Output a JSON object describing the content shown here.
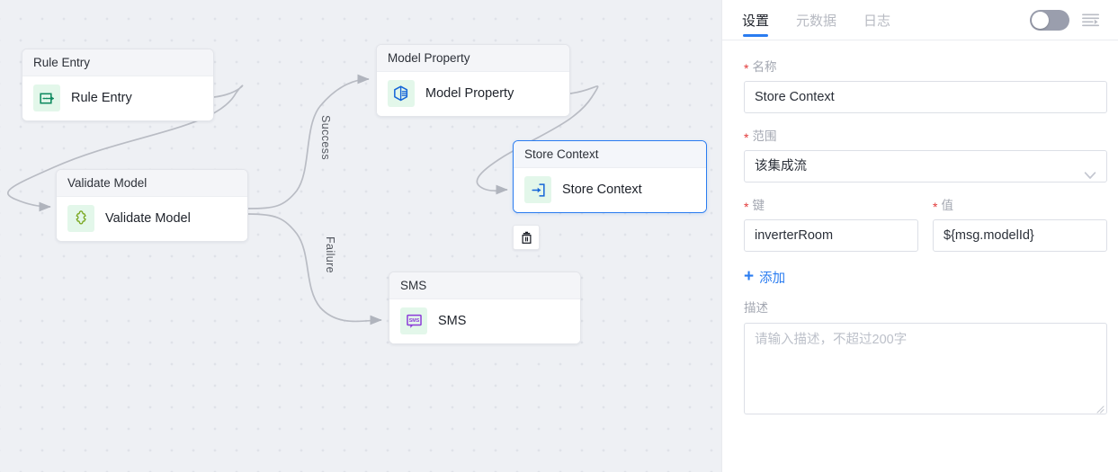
{
  "canvas": {
    "nodes": [
      {
        "id": "rule-entry",
        "header": "Rule Entry",
        "label": "Rule Entry",
        "icon": "rule-entry-icon"
      },
      {
        "id": "validate-model",
        "header": "Validate Model",
        "label": "Validate Model",
        "icon": "puzzle-piece-icon"
      },
      {
        "id": "model-property",
        "header": "Model Property",
        "label": "Model Property",
        "icon": "model-property-icon"
      },
      {
        "id": "store-context",
        "header": "Store Context",
        "label": "Store Context",
        "icon": "store-context-icon"
      },
      {
        "id": "sms",
        "header": "SMS",
        "label": "SMS",
        "icon": "sms-icon"
      }
    ],
    "edge_labels": {
      "success": "Success",
      "failure": "Failure"
    },
    "delete_button": {
      "icon": "trash-icon",
      "tooltip": ""
    },
    "selected_node": "store-context"
  },
  "panel": {
    "tabs": [
      {
        "id": "settings",
        "label": "设置",
        "active": true
      },
      {
        "id": "metadata",
        "label": "元数据",
        "active": false
      },
      {
        "id": "logs",
        "label": "日志",
        "active": false
      }
    ],
    "toggle": {
      "name": "debug-toggle",
      "state": "off"
    },
    "menu_icon": "list-expand-icon",
    "form": {
      "name": {
        "label": "名称",
        "required": "*",
        "value": "Store Context"
      },
      "scope": {
        "label": "范围",
        "required": "*",
        "value": "该集成流",
        "chevron": "chevron-down-icon"
      },
      "key": {
        "label": "键",
        "required": "*",
        "value": "inverterRoom"
      },
      "value": {
        "label": "值",
        "required": "*",
        "value": "${msg.modelId}"
      },
      "add": {
        "label": "添加",
        "plus": "+"
      },
      "description": {
        "label": "描述",
        "placeholder": "请输入描述，不超过200字",
        "value": ""
      }
    }
  },
  "colors": {
    "accent": "#2a7cf0",
    "required": "#e23b3b",
    "canvas_bg": "#eef0f4",
    "node_header_bg": "#f4f5f8",
    "edge": "#b9bcc4"
  }
}
